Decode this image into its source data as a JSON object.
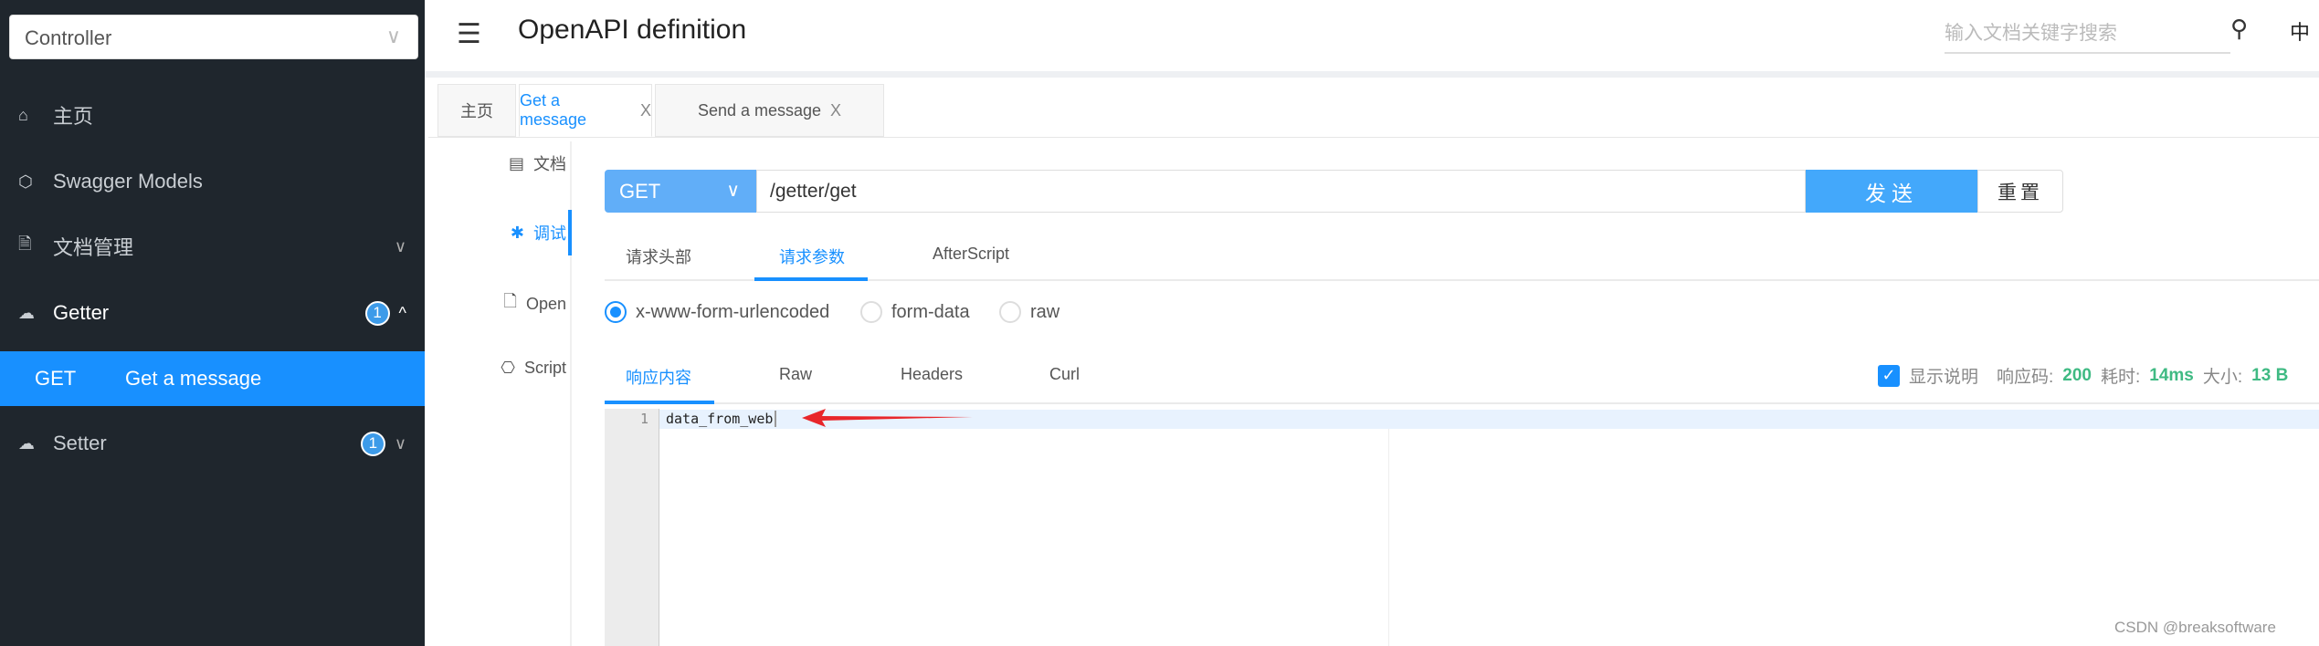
{
  "sidebar": {
    "controller_select": "Controller",
    "items": [
      {
        "label": "主页",
        "icon": "home-icon"
      },
      {
        "label": "Swagger Models",
        "icon": "cube-icon"
      },
      {
        "label": "文档管理",
        "icon": "doc-settings-icon"
      },
      {
        "label": "Getter",
        "icon": "api-cloud-icon",
        "badge": "1"
      },
      {
        "label": "Setter",
        "icon": "api-cloud-icon",
        "badge": "1"
      }
    ],
    "active_item": {
      "method": "GET",
      "label": "Get a message"
    }
  },
  "header": {
    "title": "OpenAPI definition",
    "search_placeholder": "输入文档关键字搜索",
    "lang": "中"
  },
  "tabs": [
    {
      "label": "主页"
    },
    {
      "label": "Get a message",
      "close": "X"
    },
    {
      "label": "Send a message",
      "close": "X"
    }
  ],
  "subnav": [
    {
      "label": "文档"
    },
    {
      "label": "调试"
    },
    {
      "label": "Open"
    },
    {
      "label": "Script"
    }
  ],
  "request": {
    "method": "GET",
    "url": "/getter/get",
    "send": "发送",
    "reset": "重置"
  },
  "request_tabs": [
    "请求头部",
    "请求参数",
    "AfterScript"
  ],
  "body_types": [
    "x-www-form-urlencoded",
    "form-data",
    "raw"
  ],
  "response_tabs": [
    "响应内容",
    "Raw",
    "Headers",
    "Curl"
  ],
  "response_meta": {
    "show_desc": "显示说明",
    "code_label": "响应码:",
    "code": "200",
    "time_label": "耗时:",
    "time": "14ms",
    "size_label": "大小:",
    "size": "13 B"
  },
  "editor": {
    "line": "1",
    "content": "data_from_web"
  },
  "colors": {
    "accent": "#1890ff",
    "success": "#3fba83",
    "sidebar": "#1f262d",
    "annotation_arrow": "#e8262b"
  },
  "watermark": "CSDN @breaksoftware"
}
